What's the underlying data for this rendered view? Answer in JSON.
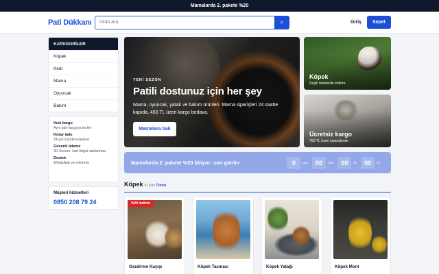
{
  "topbar": {
    "text": "Mamalarda 2. pakete %20"
  },
  "header": {
    "logo": "Pati Dükkanı",
    "search_placeholder": "Ürün ara",
    "search_icon": "search-icon",
    "login_label": "Giriş",
    "cart_label": "Sepet"
  },
  "sidebar": {
    "categories_title": "KATEGORİLER",
    "categories": [
      {
        "label": "Köpek"
      },
      {
        "label": "Kedi"
      },
      {
        "label": "Mama"
      },
      {
        "label": "Oyuncak"
      },
      {
        "label": "Bakım"
      }
    ],
    "info": [
      {
        "title": "Hızlı kargo",
        "desc": "Aynı gün kargoya teslim"
      },
      {
        "title": "Kolay iade",
        "desc": "14 gün içinde koşulsuz"
      },
      {
        "title": "Güvenli ödeme",
        "desc": "3D Secure, kart bilgisi saklanmaz"
      },
      {
        "title": "Destek",
        "desc": "WhatsApp ve telefonla"
      }
    ],
    "contact": {
      "title": "Müşteri hizmetleri",
      "phone": "0850 208 79 24"
    }
  },
  "hero": {
    "kicker": "YENİ SEZON",
    "title": "Patili dostunuz için her şey",
    "desc": "Mama, oyuncak, yatak ve bakım ürünleri. Mama siparişleri 24 saatte kapıda, 400 TL üzeri kargo bedava.",
    "button": "Mamalara bak"
  },
  "promos": [
    {
      "title": "Köpek",
      "sub": "Seçili ürünlerde indirim"
    },
    {
      "title": "Ücretsiz kargo",
      "sub": "750 TL üzeri siparişlerde"
    }
  ],
  "countdown": {
    "text": "Mamalarda 2. pakete %20 bitiyor: son günler",
    "timer": [
      {
        "value": "0",
        "unit": "gün"
      },
      {
        "value": "00",
        "unit": "saat"
      },
      {
        "value": "00",
        "unit": "dk"
      },
      {
        "value": "00",
        "unit": "sn"
      }
    ]
  },
  "section": {
    "title": "Köpek",
    "count": "4 ürün",
    "all_label": "Tümü"
  },
  "products": [
    {
      "name": "Gezdirme Kayışı",
      "badge": "%20 indirim"
    },
    {
      "name": "Köpek Tasması",
      "badge": ""
    },
    {
      "name": "Köpek Yatağı",
      "badge": ""
    },
    {
      "name": "Köpek Mont",
      "badge": ""
    }
  ],
  "colors": {
    "brand": "#1d4ed8",
    "dark": "#0f172a",
    "countdown_bg": "#93a8e8",
    "badge": "#dc2626"
  }
}
